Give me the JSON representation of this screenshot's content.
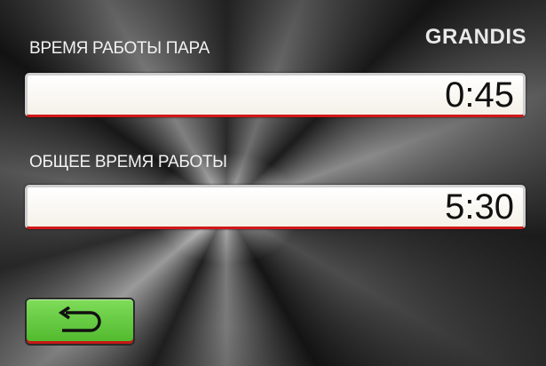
{
  "brand": "GRANDIS",
  "steam_time": {
    "label": "ВРЕМЯ РАБОТЫ ПАРА",
    "value": "0:45"
  },
  "total_time": {
    "label": "ОБЩЕЕ ВРЕМЯ РАБОТЫ",
    "value": "5:30"
  },
  "back_button": {
    "icon": "back-arrow-icon",
    "color": "#5cc43a"
  },
  "colors": {
    "field_border_accent": "#d01818",
    "text": "#f2f2f2"
  }
}
